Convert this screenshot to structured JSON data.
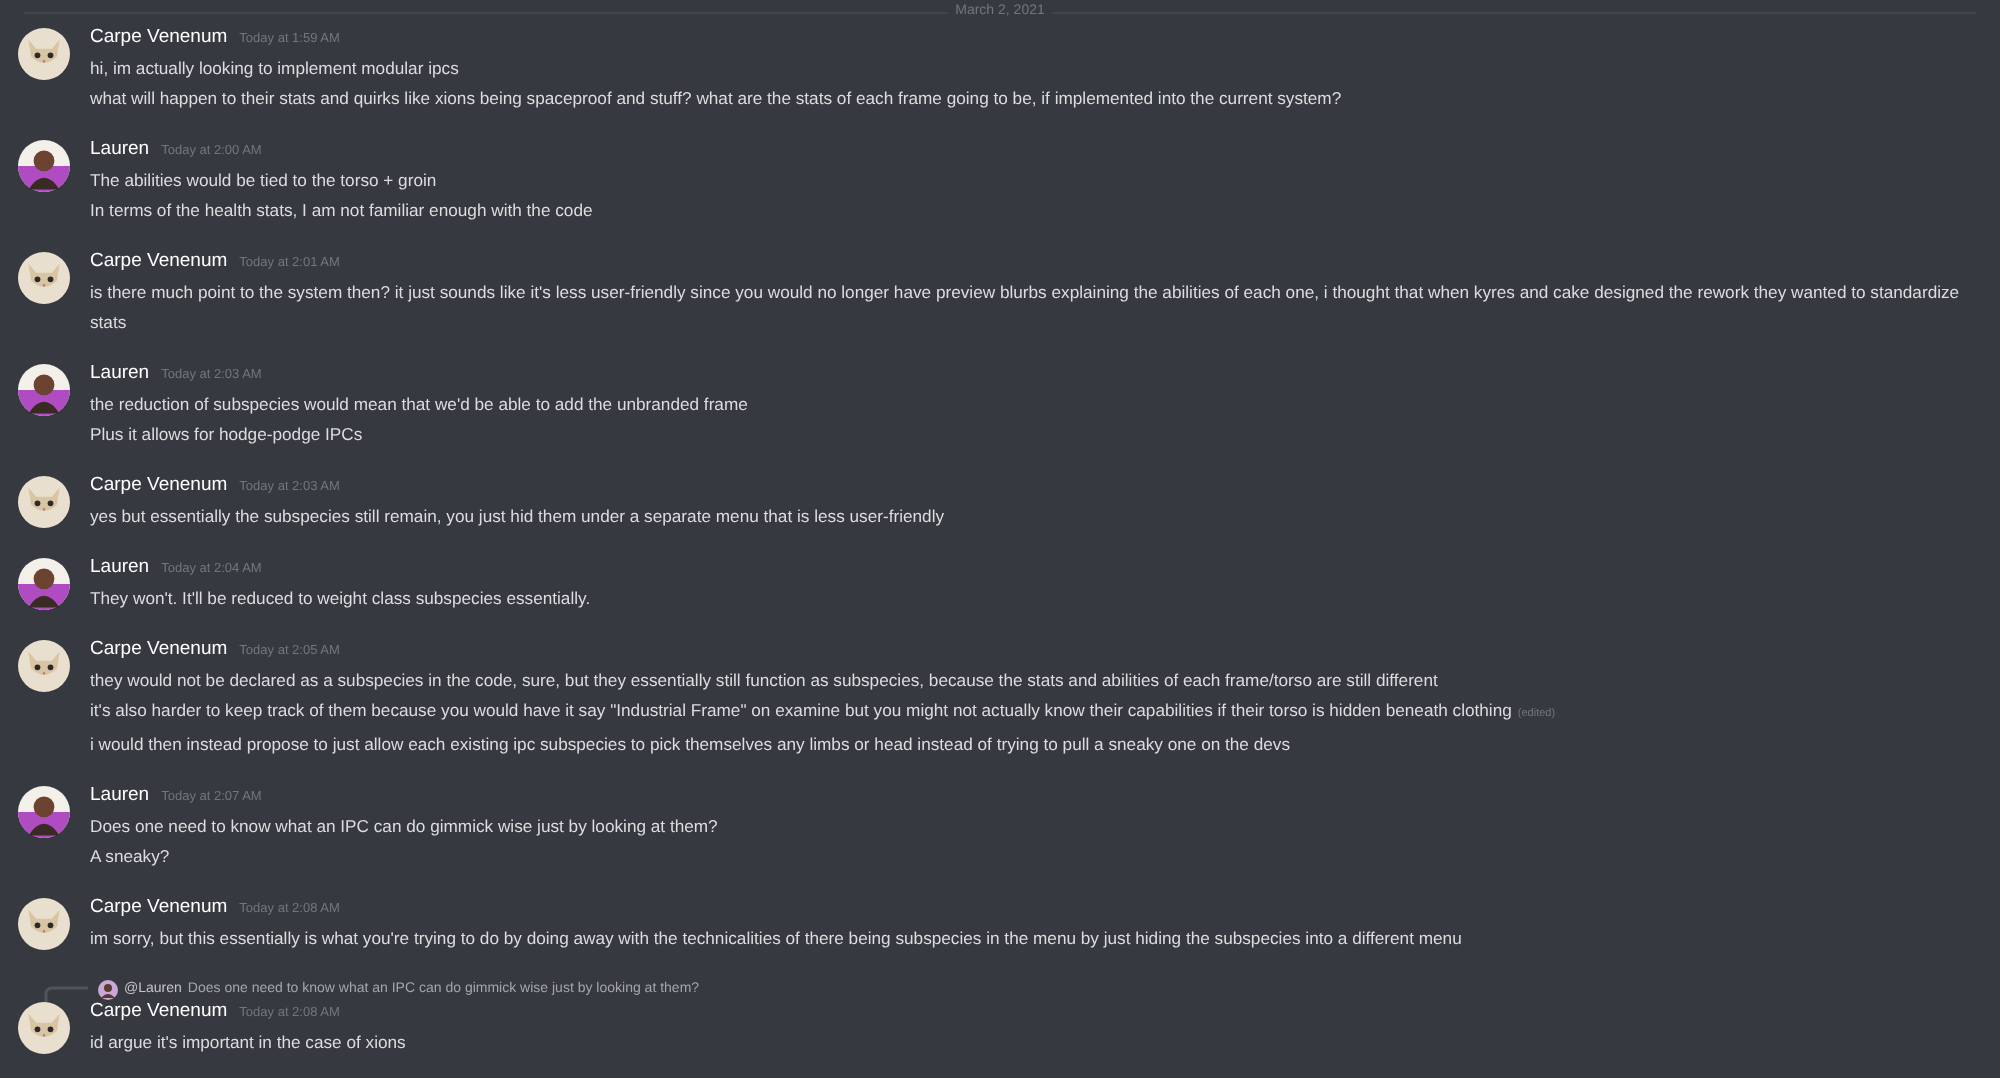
{
  "date_divider": "March 2, 2021",
  "messages": [
    {
      "author": "Carpe Venenum",
      "kind": "cat",
      "time": "Today at 1:59 AM",
      "lines": [
        {
          "text": "hi, im actually looking to implement modular ipcs"
        },
        {
          "text": "what will happen to their stats and quirks like xions being spaceproof and stuff? what are the stats of each frame going to be, if implemented into the current system?"
        }
      ]
    },
    {
      "author": "Lauren",
      "kind": "person",
      "time": "Today at 2:00 AM",
      "lines": [
        {
          "text": "The abilities would be tied to the torso + groin"
        },
        {
          "text": "In terms of the health stats, I am not familiar enough with the code"
        }
      ]
    },
    {
      "author": "Carpe Venenum",
      "kind": "cat",
      "time": "Today at 2:01 AM",
      "lines": [
        {
          "text": "is there much point to the system then? it just sounds like it's less user-friendly since you would no longer have preview blurbs explaining the abilities of each one, i thought that when kyres and cake designed the rework they wanted to standardize stats"
        }
      ]
    },
    {
      "author": "Lauren",
      "kind": "person",
      "time": "Today at 2:03 AM",
      "lines": [
        {
          "text": "the reduction of subspecies would mean that we'd be able to add the unbranded frame"
        },
        {
          "text": "Plus it allows for hodge-podge IPCs"
        }
      ]
    },
    {
      "author": "Carpe Venenum",
      "kind": "cat",
      "time": "Today at 2:03 AM",
      "lines": [
        {
          "text": "yes but essentially the subspecies still remain, you just hid them under a separate menu that is less user-friendly"
        }
      ]
    },
    {
      "author": "Lauren",
      "kind": "person",
      "time": "Today at 2:04 AM",
      "lines": [
        {
          "text": "They won't. It'll be reduced to weight class subspecies essentially."
        }
      ]
    },
    {
      "author": "Carpe Venenum",
      "kind": "cat",
      "time": "Today at 2:05 AM",
      "lines": [
        {
          "text": "they would not be declared as a subspecies in the code, sure, but they essentially still function as subspecies, because the stats and abilities of each frame/torso are still different"
        },
        {
          "text": "it's also harder to keep track of them because you would have it say \"Industrial Frame\" on examine but you might not actually know their capabilities if their torso is hidden beneath clothing",
          "edited": "(edited)"
        },
        {
          "text": "i would then instead propose to just allow each existing ipc subspecies to pick themselves any limbs or head instead of trying to pull a sneaky one on the devs"
        }
      ]
    },
    {
      "author": "Lauren",
      "kind": "person",
      "time": "Today at 2:07 AM",
      "lines": [
        {
          "text": "Does one need to know what an IPC can do gimmick wise just by looking at them?"
        },
        {
          "text": "A sneaky?"
        }
      ]
    },
    {
      "author": "Carpe Venenum",
      "kind": "cat",
      "time": "Today at 2:08 AM",
      "lines": [
        {
          "text": "im sorry, but this essentially is what you're trying to do by doing away with the technicalities of there being subspecies in the menu by just hiding the subspecies into a different menu"
        }
      ]
    },
    {
      "author": "Carpe Venenum",
      "kind": "cat",
      "time": "Today at 2:08 AM",
      "reply": {
        "mention": "@Lauren",
        "kind": "person",
        "text": "Does one need to know what an IPC can do gimmick wise just by looking at them?"
      },
      "lines": [
        {
          "text": "id argue it's important in the case of xions"
        }
      ]
    }
  ]
}
